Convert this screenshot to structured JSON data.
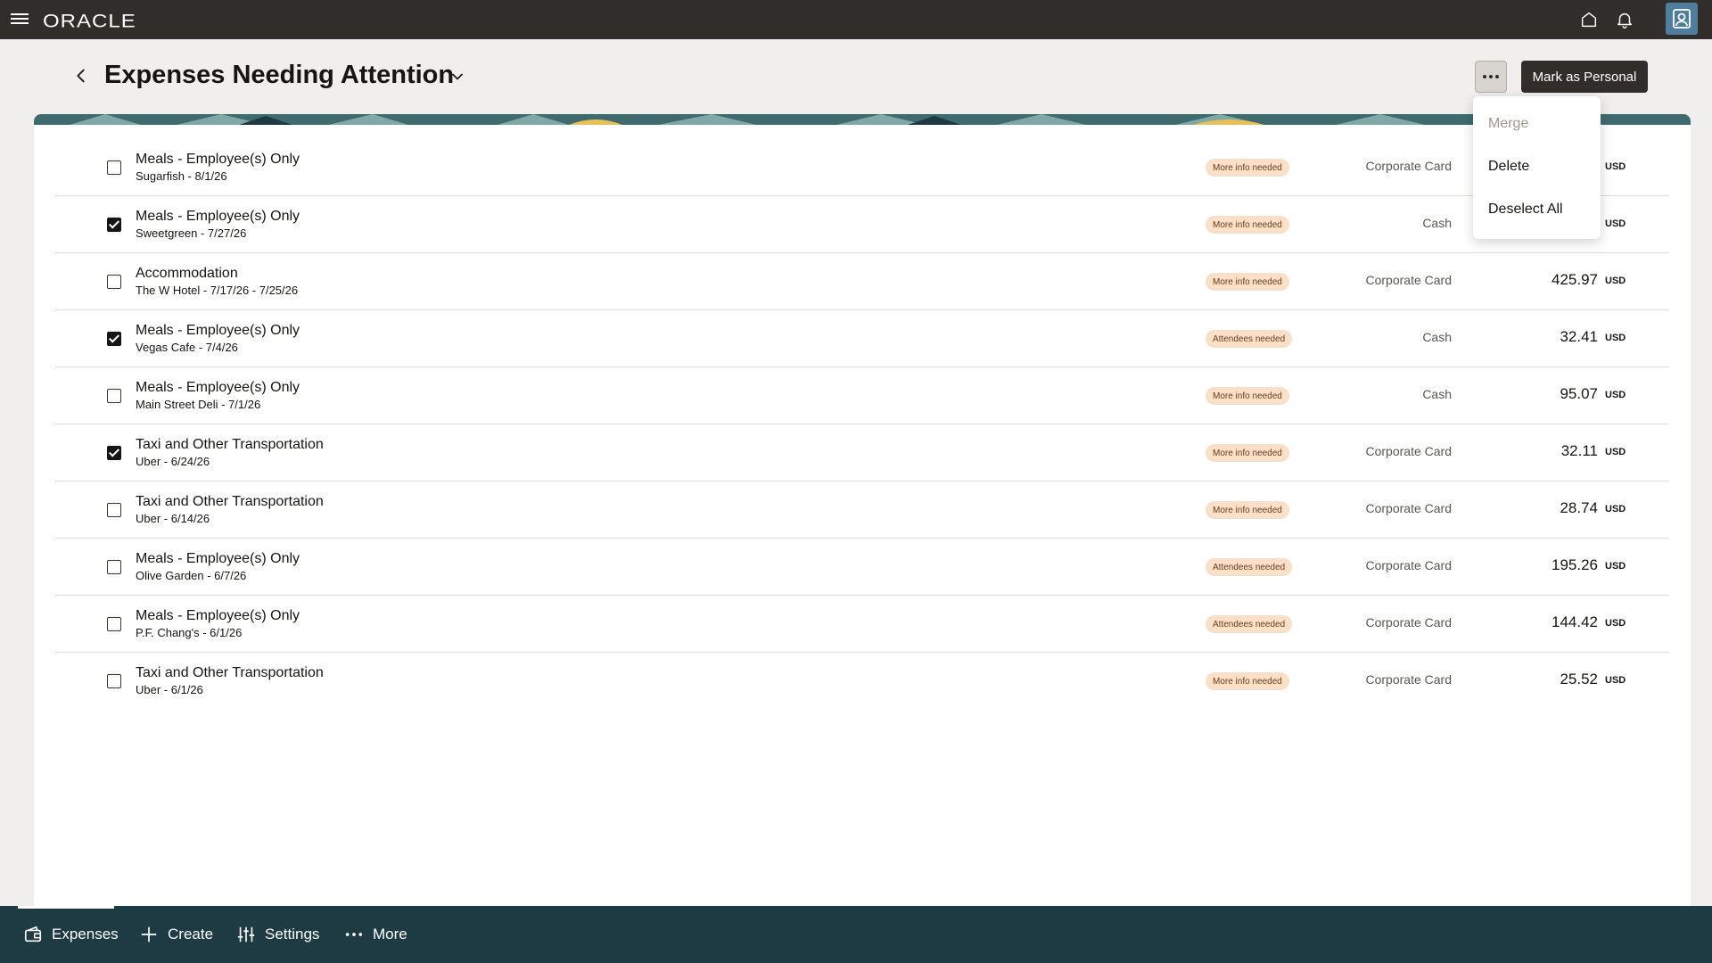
{
  "app": {
    "brand": "ORACLE"
  },
  "header": {
    "title": "Expenses Needing Attention",
    "primary_action": "Mark as Personal"
  },
  "menu": {
    "items": [
      {
        "label": "Merge",
        "enabled": false
      },
      {
        "label": "Delete",
        "enabled": true
      },
      {
        "label": "Deselect All",
        "enabled": true
      }
    ]
  },
  "expenses": [
    {
      "title": "Meals - Employee(s) Only",
      "sub": "Sugarfish - 8/1/26",
      "badge": "More info needed",
      "payment": "Corporate Card",
      "amount": "",
      "currency": "USD",
      "checked": false
    },
    {
      "title": "Meals - Employee(s) Only",
      "sub": "Sweetgreen - 7/27/26",
      "badge": "More info needed",
      "payment": "Cash",
      "amount": "",
      "currency": "USD",
      "checked": true
    },
    {
      "title": "Accommodation",
      "sub": "The W Hotel - 7/17/26 - 7/25/26",
      "badge": "More info needed",
      "payment": "Corporate Card",
      "amount": "425.97",
      "currency": "USD",
      "checked": false
    },
    {
      "title": "Meals - Employee(s) Only",
      "sub": "Vegas Cafe - 7/4/26",
      "badge": "Attendees needed",
      "payment": "Cash",
      "amount": "32.41",
      "currency": "USD",
      "checked": true
    },
    {
      "title": "Meals - Employee(s) Only",
      "sub": "Main Street Deli - 7/1/26",
      "badge": "More info needed",
      "payment": "Cash",
      "amount": "95.07",
      "currency": "USD",
      "checked": false
    },
    {
      "title": "Taxi and Other Transportation",
      "sub": "Uber - 6/24/26",
      "badge": "More info needed",
      "payment": "Corporate Card",
      "amount": "32.11",
      "currency": "USD",
      "checked": true
    },
    {
      "title": "Taxi and Other Transportation",
      "sub": "Uber - 6/14/26",
      "badge": "More info needed",
      "payment": "Corporate Card",
      "amount": "28.74",
      "currency": "USD",
      "checked": false
    },
    {
      "title": "Meals - Employee(s) Only",
      "sub": "Olive Garden - 6/7/26",
      "badge": "Attendees needed",
      "payment": "Corporate Card",
      "amount": "195.26",
      "currency": "USD",
      "checked": false
    },
    {
      "title": "Meals - Employee(s) Only",
      "sub": "P.F. Chang's - 6/1/26",
      "badge": "Attendees needed",
      "payment": "Corporate Card",
      "amount": "144.42",
      "currency": "USD",
      "checked": false
    },
    {
      "title": "Taxi and Other Transportation",
      "sub": "Uber - 6/1/26",
      "badge": "More info needed",
      "payment": "Corporate Card",
      "amount": "25.52",
      "currency": "USD",
      "checked": false
    }
  ],
  "bottom_nav": {
    "expenses": "Expenses",
    "create": "Create",
    "settings": "Settings",
    "more": "More"
  },
  "colors": {
    "top_bar": "#312d2a",
    "bottom_bar": "#1e3a43",
    "badge_bg": "#fbe0c8",
    "user_button": "#4f7e9c"
  }
}
